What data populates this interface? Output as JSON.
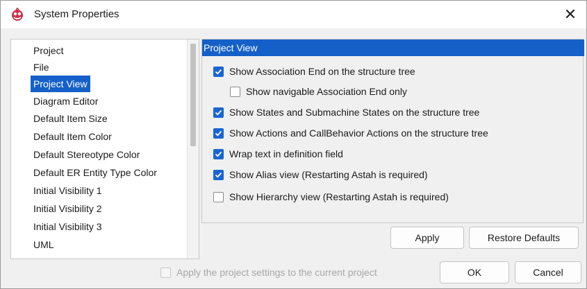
{
  "window": {
    "title": "System Properties",
    "close_glyph": "✕",
    "app_icon": "astah-logo-icon"
  },
  "nav": {
    "items": [
      {
        "label": "Project",
        "selected": false
      },
      {
        "label": "File",
        "selected": false
      },
      {
        "label": "Project View",
        "selected": true
      },
      {
        "label": "Diagram Editor",
        "selected": false
      },
      {
        "label": "Default Item Size",
        "selected": false
      },
      {
        "label": "Default Item Color",
        "selected": false
      },
      {
        "label": "Default Stereotype Color",
        "selected": false
      },
      {
        "label": "Default ER Entity Type Color",
        "selected": false
      },
      {
        "label": "Initial Visibility 1",
        "selected": false
      },
      {
        "label": "Initial Visibility 2",
        "selected": false
      },
      {
        "label": "Initial Visibility 3",
        "selected": false
      },
      {
        "label": "UML",
        "selected": false
      }
    ]
  },
  "panel": {
    "header": "Project View",
    "options": [
      {
        "label": "Show Association End on the structure tree",
        "checked": true
      },
      {
        "label": "Show navigable Association End only",
        "checked": false
      },
      {
        "label": "Show States and Submachine States on the structure tree",
        "checked": true
      },
      {
        "label": "Show Actions and CallBehavior Actions on the structure tree",
        "checked": true
      },
      {
        "label": "Wrap text in definition field",
        "checked": true
      },
      {
        "label": "Show Alias view (Restarting Astah is required)",
        "checked": true
      },
      {
        "label": "Show Hierarchy view (Restarting Astah is required)",
        "checked": false
      }
    ],
    "apply_label": "Apply",
    "restore_label": "Restore Defaults"
  },
  "footer": {
    "apply_project_label": "Apply the project settings to the current project",
    "apply_project_checked": false,
    "ok_label": "OK",
    "cancel_label": "Cancel"
  },
  "colors": {
    "accent": "#1560c8",
    "checkbox": "#1a66d1"
  }
}
